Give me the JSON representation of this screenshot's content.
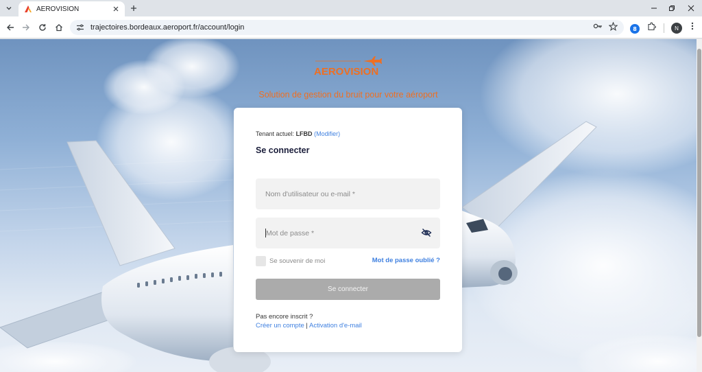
{
  "browser": {
    "tab_title": "AEROVISION",
    "url": "trajectoires.bordeaux.aeroport.fr/account/login",
    "extension_badge": "8",
    "profile_initial": "N"
  },
  "page": {
    "logo_text": "AEROVISION",
    "tagline": "Solution de gestion du bruit pour votre aéroport"
  },
  "login": {
    "tenant_label": "Tenant actuel:",
    "tenant_code": "LFBD",
    "tenant_open": "(",
    "tenant_modify": "Modifier",
    "tenant_close": ")",
    "heading": "Se connecter",
    "username_placeholder": "Nom d'utilisateur ou e-mail *",
    "password_placeholder": "Mot de passe *",
    "remember_label": "Se souvenir de moi",
    "forgot_link": "Mot de passe oublié ?",
    "submit_label": "Se connecter",
    "not_registered": "Pas encore inscrit ?",
    "create_account": "Créer un compte",
    "separator": "|",
    "email_activation": "Activation d'e-mail"
  },
  "colors": {
    "brand_orange": "#ee6f22",
    "link_blue": "#3f80e0",
    "button_disabled": "#ababab"
  },
  "icons": {
    "tab_favicon": "aerovision-logo-icon",
    "password_toggle": "eye-slash-icon"
  }
}
